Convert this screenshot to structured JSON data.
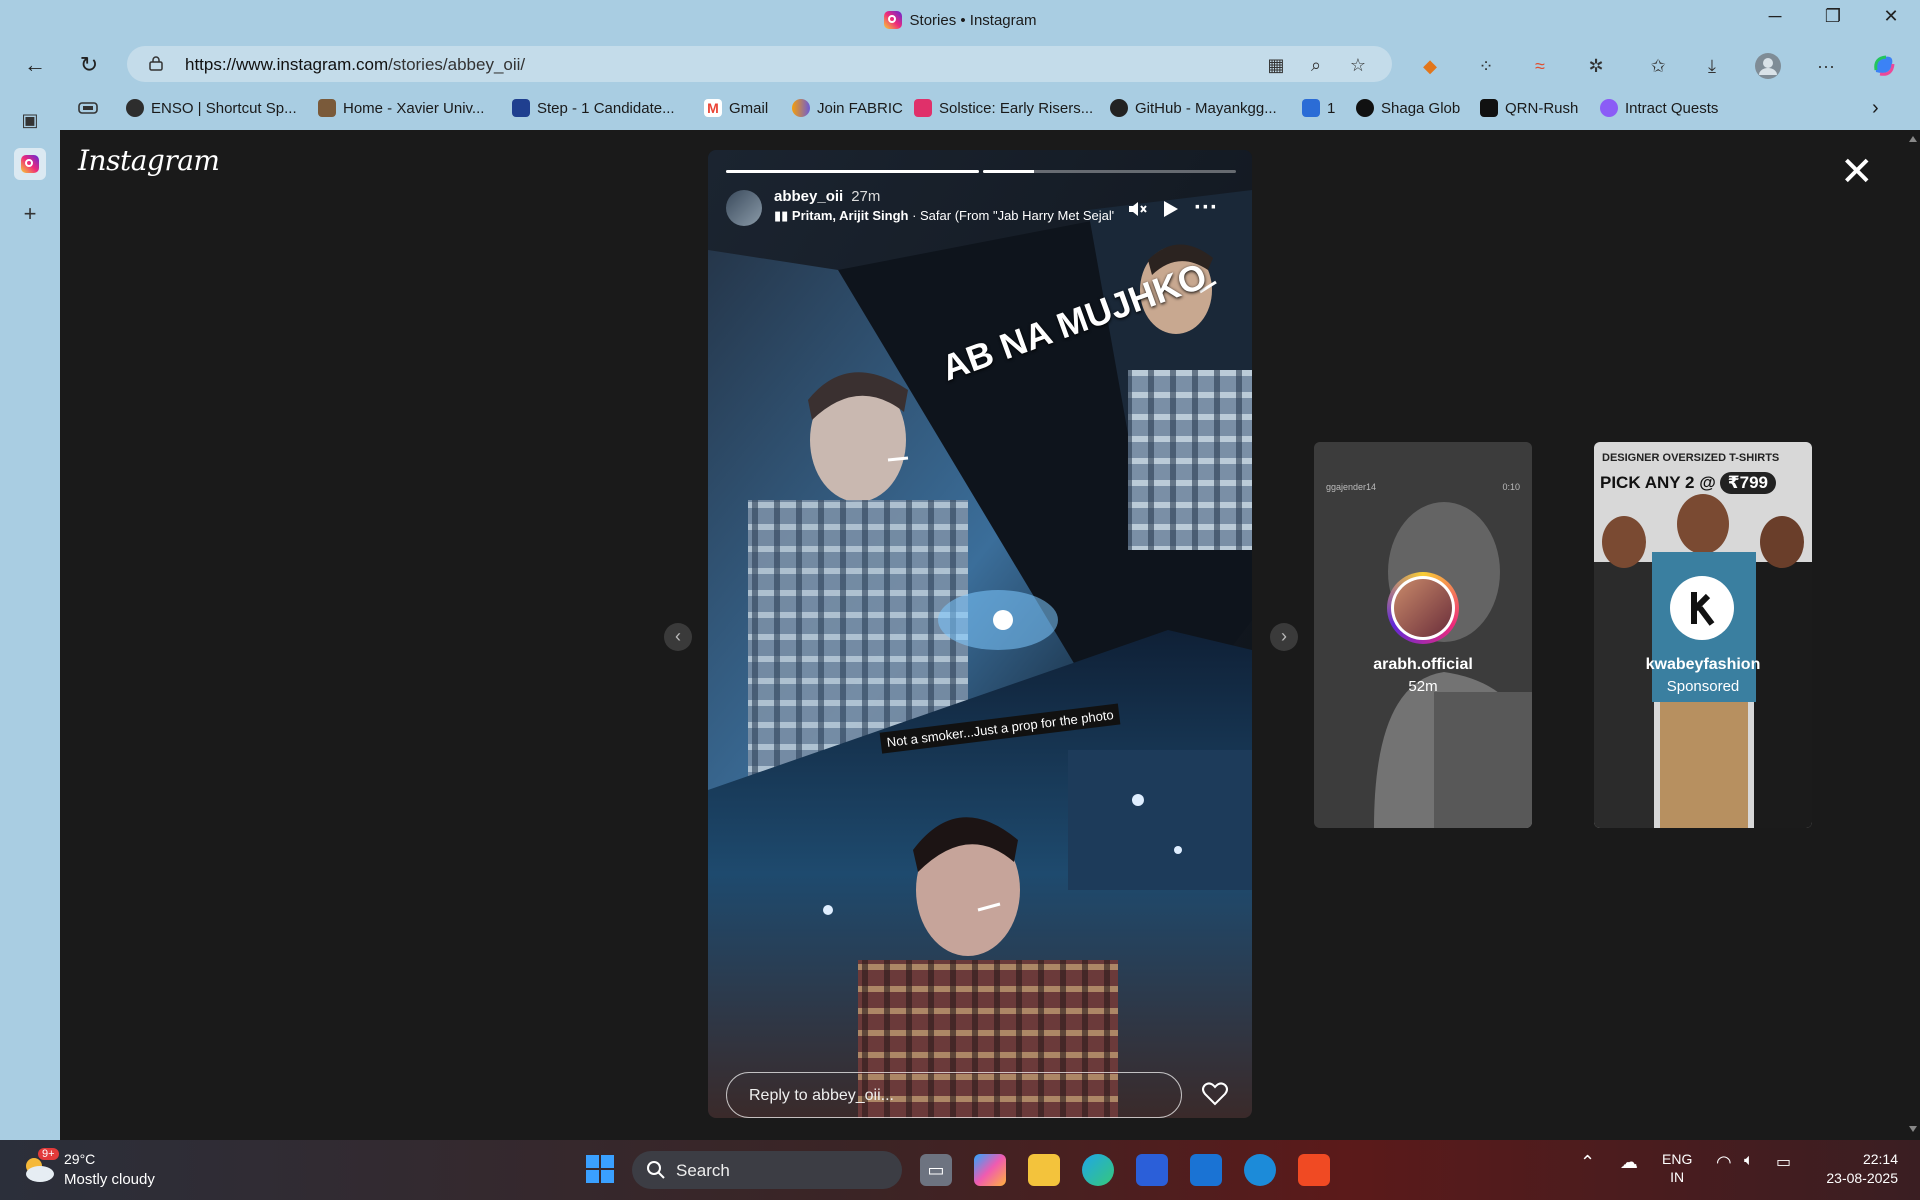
{
  "window": {
    "title": "Stories • Instagram",
    "min": "─",
    "restore": "❐",
    "close": "✕"
  },
  "toolbar": {
    "back": "←",
    "reload": "↻",
    "url_domain": "https://www.instagram.com",
    "url_path": "/stories/abbey_oii/",
    "more": "···"
  },
  "bookmarks": [
    {
      "label": "ENSO | Shortcut Sp...",
      "color": "#2d2d2d"
    },
    {
      "label": "Home - Xavier Univ...",
      "color": "#7a5a3a"
    },
    {
      "label": "Step - 1 Candidate...",
      "color": "#1f3f8f"
    },
    {
      "label": "Gmail",
      "color": "#ea4335"
    },
    {
      "label": "Join FABRIC",
      "color": "#6b5bd6"
    },
    {
      "label": "Solstice: Early Risers...",
      "color": "#e0306a"
    },
    {
      "label": "GitHub - Mayankgg...",
      "color": "#222222"
    },
    {
      "label": "1",
      "color": "#2b6cd6"
    },
    {
      "label": "Shaga Glob",
      "color": "#111111"
    },
    {
      "label": "QRN-Rush",
      "color": "#111111"
    },
    {
      "label": "Intract Quests",
      "color": "#8b5cf6"
    }
  ],
  "instagram": {
    "logo": "Instagram",
    "close": "✕"
  },
  "story": {
    "username": "abbey_oii",
    "time": "27m",
    "music_artist": "Pritam, Arijit Singh",
    "music_title": " · Safar (From \"Jab Harry Met Sejal\"",
    "progress": [
      1.0,
      0.2
    ],
    "overlay_text": "AB NA MUJHKO",
    "caption": "Not a smoker...Just a prop for the photo",
    "reply_placeholder": "Reply to abbey_oii..."
  },
  "next_stories": [
    {
      "name": "arabh.official",
      "sub": "52m",
      "watermark": "ggajender14",
      "duration": "0:10"
    },
    {
      "name": "kwabeyfashion",
      "sub": "Sponsored",
      "ad_line1": "DESIGNER OVERSIZED T-SHIRTS",
      "ad_line2": "PICK ANY 2 @",
      "ad_price": "₹799"
    }
  ],
  "taskbar": {
    "temp": "29°C",
    "weather": "Mostly cloudy",
    "badge": "9+",
    "search": "Search",
    "lang1": "ENG",
    "lang2": "IN",
    "time": "22:14",
    "date": "23-08-2025"
  }
}
